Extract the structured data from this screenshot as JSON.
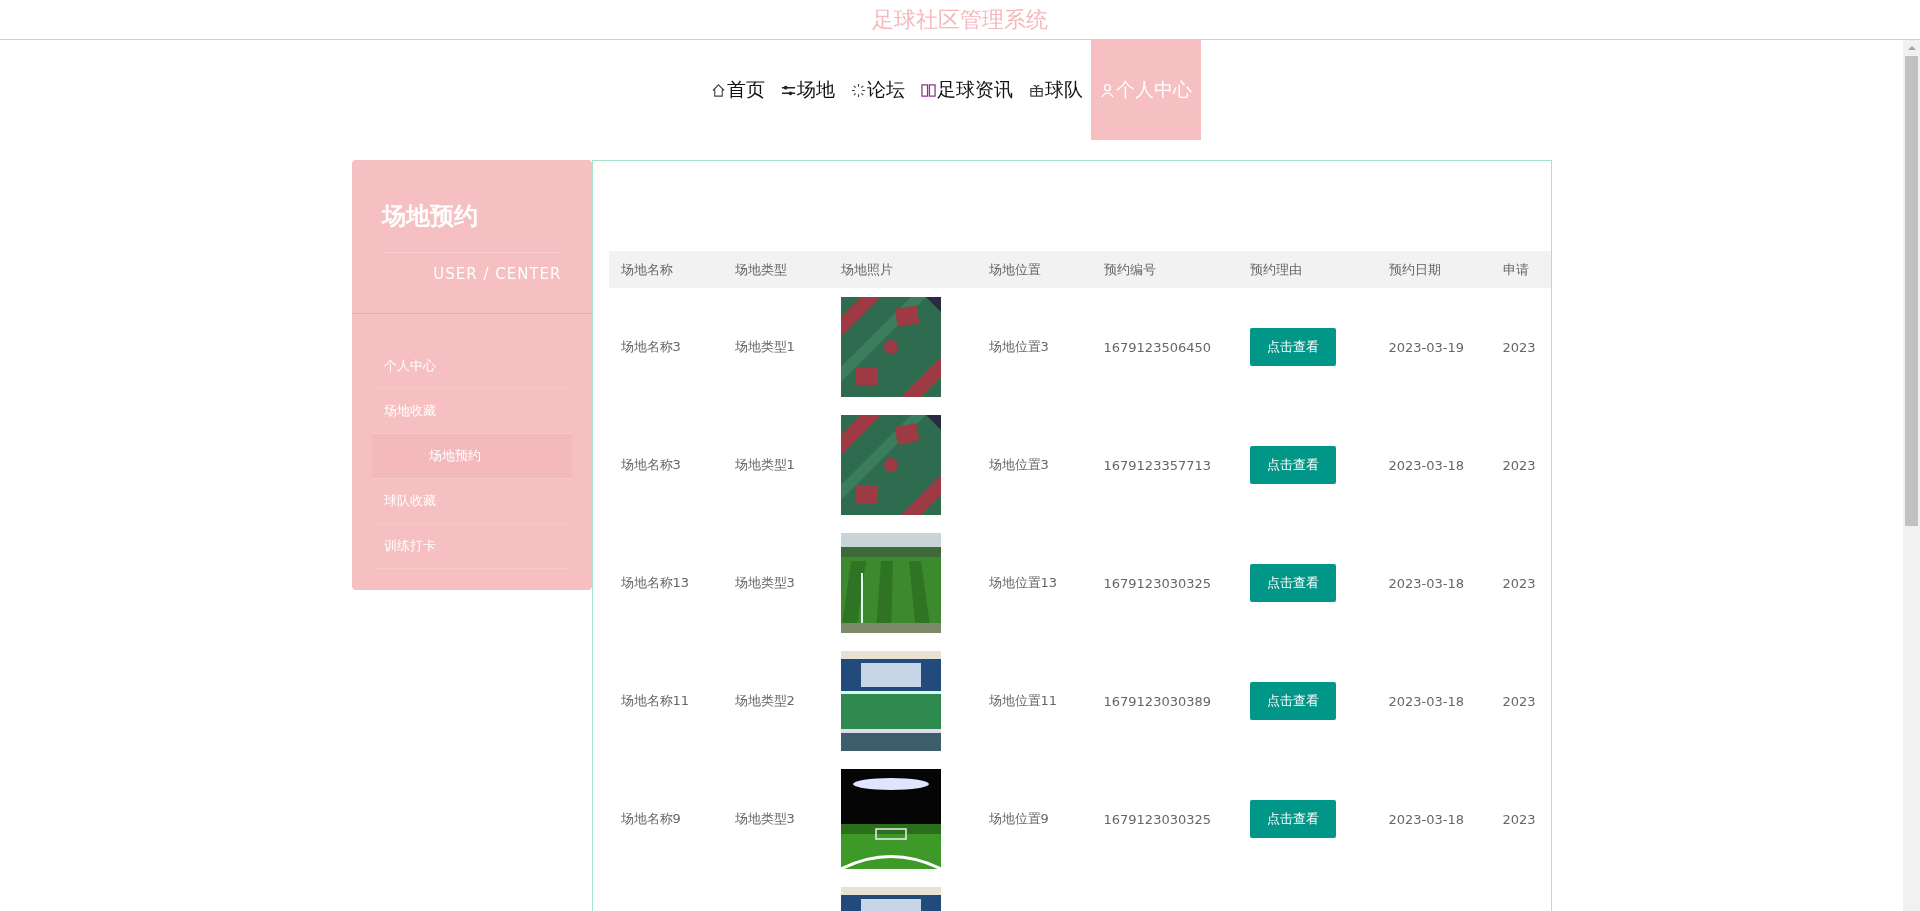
{
  "site_title": "足球社区管理系统",
  "nav": [
    {
      "label": "首页",
      "selected": false
    },
    {
      "label": "场地",
      "selected": false
    },
    {
      "label": "论坛",
      "selected": false
    },
    {
      "label": "足球资讯",
      "selected": false
    },
    {
      "label": "球队",
      "selected": false
    },
    {
      "label": "个人中心",
      "selected": true
    }
  ],
  "sidebar": {
    "title": "场地预约",
    "subtitle": "USER / CENTER",
    "items": [
      {
        "label": "个人中心",
        "selected": false
      },
      {
        "label": "场地收藏",
        "selected": false
      },
      {
        "label": "场地预约",
        "selected": true
      },
      {
        "label": "球队收藏",
        "selected": false
      },
      {
        "label": "训练打卡",
        "selected": false
      }
    ]
  },
  "table": {
    "columns": [
      "场地名称",
      "场地类型",
      "场地照片",
      "场地位置",
      "预约编号",
      "预约理由",
      "预约日期",
      "申请"
    ],
    "rows": [
      {
        "name": "场地名称3",
        "type": "场地类型1",
        "photo": {
          "kind": "picture"
        },
        "location": "场地位置3",
        "number": "1679123506450",
        "reason": "点击查看",
        "date": "2023-03-19",
        "column_8": "2023"
      },
      {
        "name": "场地名称3",
        "type": "场地类型1",
        "photo": {
          "kind": "picture"
        },
        "location": "场地位置3",
        "number": "1679123357713",
        "reason": "点击查看",
        "date": "2023-03-18",
        "column_8": "2023"
      },
      {
        "name": "场地名称13",
        "type": "场地类型3",
        "photo": {
          "kind": "picture"
        },
        "location": "场地位置13",
        "number": "1679123030325",
        "reason": "点击查看",
        "date": "2023-03-18",
        "column_8": "2023"
      },
      {
        "name": "场地名称11",
        "type": "场地类型2",
        "photo": {
          "kind": "picture"
        },
        "location": "场地位置11",
        "number": "1679123030389",
        "reason": "点击查看",
        "date": "2023-03-18",
        "column_8": "2023"
      },
      {
        "name": "场地名称9",
        "type": "场地类型3",
        "photo": {
          "kind": "picture"
        },
        "location": "场地位置9",
        "number": "1679123030325",
        "reason": "点击查看",
        "date": "2023-03-18",
        "column_8": "2023"
      },
      {
        "photo": {
          "kind": "picture"
        }
      }
    ]
  }
}
